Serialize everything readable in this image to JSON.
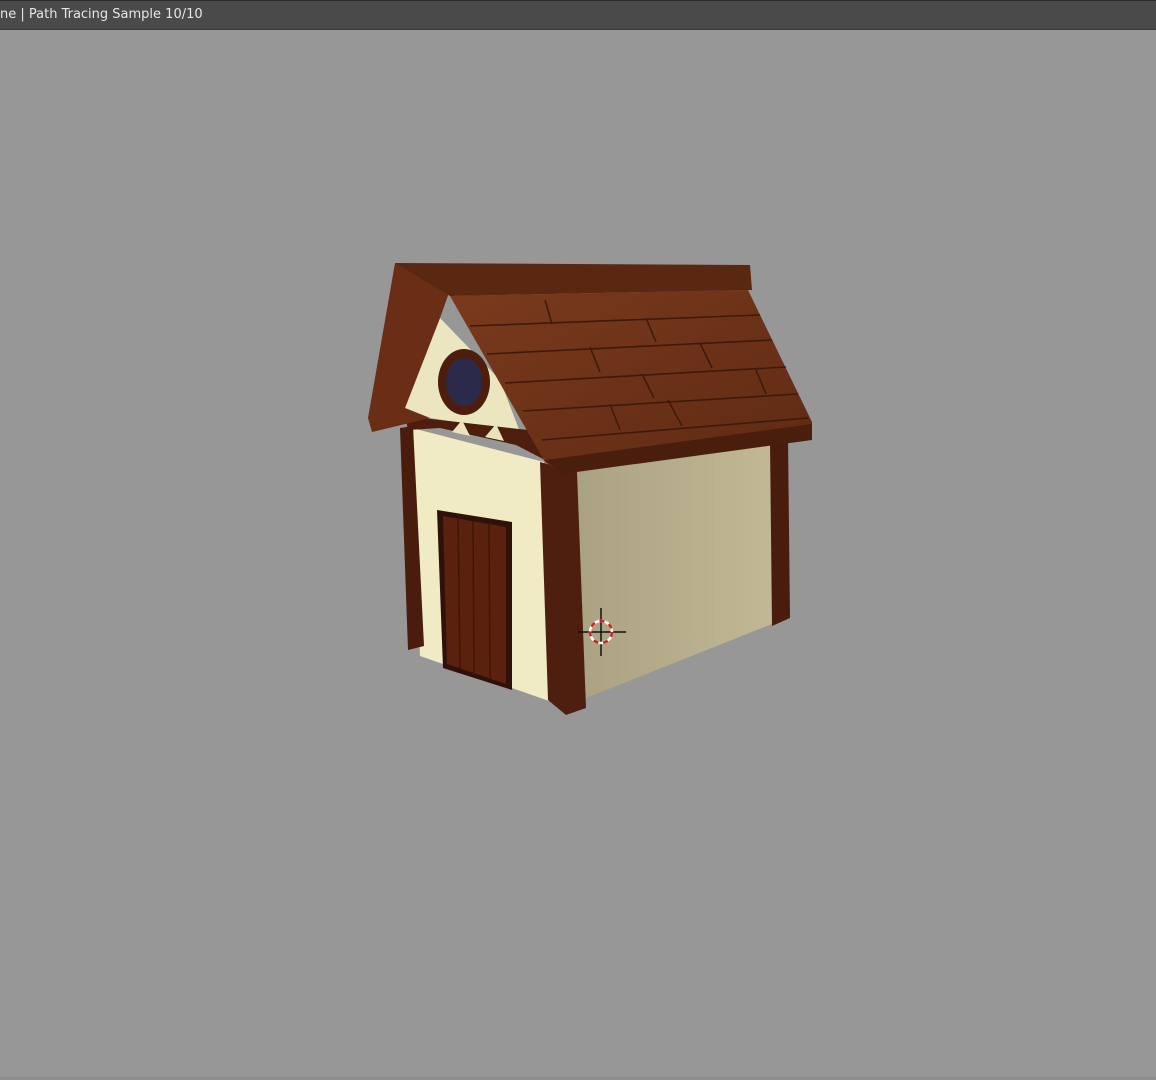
{
  "viewport": {
    "status_text": "ne | Path Tracing Sample 10/10",
    "background_color": "#979797"
  },
  "scene": {
    "object": "cottage",
    "colors": {
      "roof_wood": "#6e3219",
      "roof_wood_dark": "#4a1e0d",
      "beam_wood": "#4d1e0e",
      "front_wall": "#f1ebc6",
      "side_wall": "#b3ab8a",
      "door": "#5a210f",
      "window": "#2b2b4a"
    },
    "cursor": "3d-cursor-icon"
  }
}
